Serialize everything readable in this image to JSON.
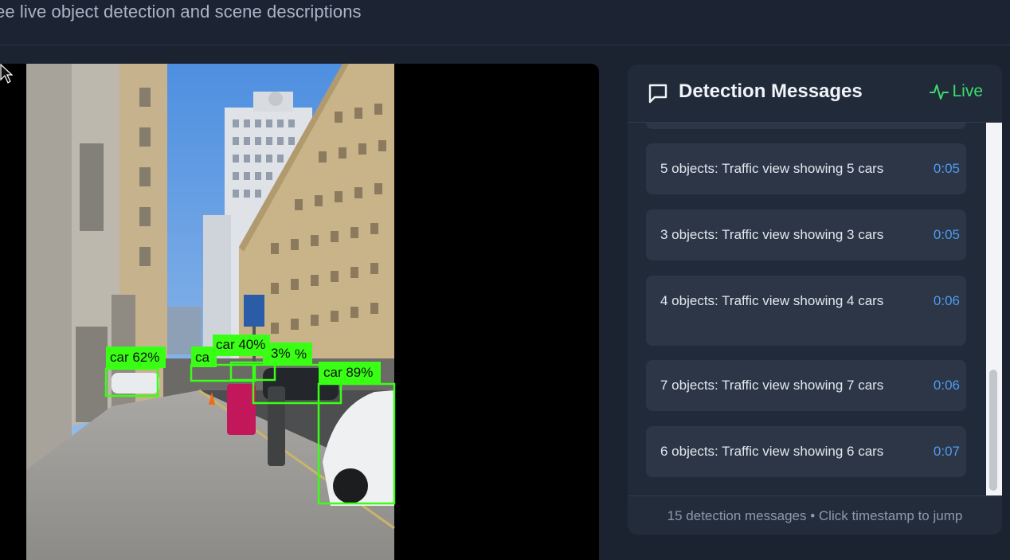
{
  "header": {
    "subtitle": "ee live object detection and scene descriptions"
  },
  "video": {
    "detections": [
      {
        "label": "car 62%"
      },
      {
        "label": "ca"
      },
      {
        "label": "car 40%"
      },
      {
        "label": "3%"
      },
      {
        "label": "%"
      },
      {
        "label": "car 89%"
      }
    ]
  },
  "panel": {
    "title": "Detection Messages",
    "status": "Live",
    "messages": [
      {
        "text": "5 objects: Traffic view showing 5 cars",
        "time": "0:05"
      },
      {
        "text": "3 objects: Traffic view showing 3 cars",
        "time": "0:05"
      },
      {
        "text": "4 objects: Traffic view showing 4 cars",
        "time": "0:06"
      },
      {
        "text": "7 objects: Traffic view showing 7 cars",
        "time": "0:06"
      },
      {
        "text": "6 objects: Traffic view showing 6 cars",
        "time": "0:07"
      }
    ],
    "footer": "15 detection messages • Click timestamp to jump"
  },
  "colors": {
    "detection_box": "#39ff14",
    "live": "#3ddc6c",
    "timestamp": "#4f9cf0"
  }
}
